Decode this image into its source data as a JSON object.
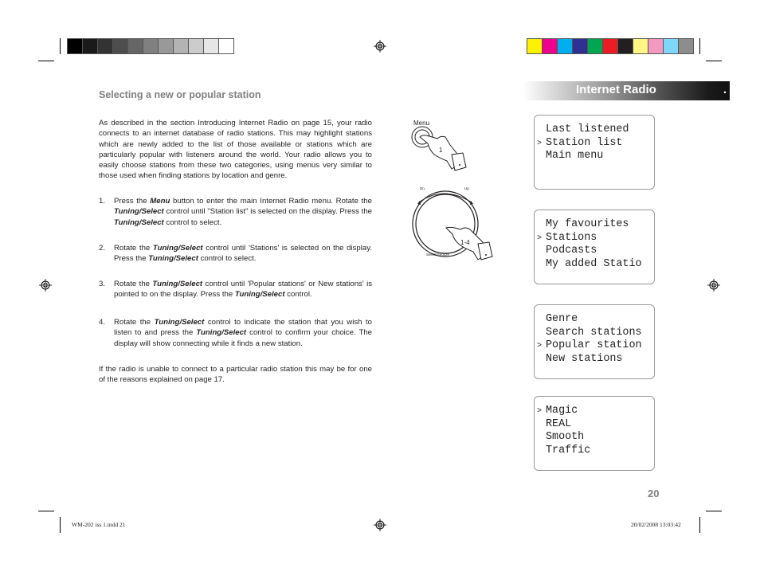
{
  "print_marks": {
    "grayscale_swatches": [
      "#000000",
      "#1a1a1a",
      "#333333",
      "#4d4d4d",
      "#666666",
      "#808080",
      "#999999",
      "#b3b3b3",
      "#cccccc",
      "#e6e6e6",
      "#ffffff"
    ],
    "color_swatches": [
      "#fff200",
      "#ec008c",
      "#00aeef",
      "#2e3192",
      "#00a651",
      "#ed1c24",
      "#231f20",
      "#fff685",
      "#f49ac1",
      "#7dd8f8",
      "#8d8d8d"
    ]
  },
  "section_banner": {
    "title": "Internet Radio",
    "trailing_mark": "."
  },
  "heading": "Selecting a new or popular station",
  "intro": "As described in the section Introducing Internet Radio on page 15, your radio connects to an internet database of radio stations. This may highlight stations which are newly added to the list of those available or stations which are particularly popular with listeners around the world. Your radio allows you to easily choose stations from these two categories, using menus very similar to those used when finding stations by location and genre.",
  "steps": [
    {
      "number": "1.",
      "parts": [
        "Press the ",
        "Menu",
        " button to enter the main Internet Radio menu. Rotate the ",
        "Tuning/Select",
        " control until \"Station list\" is selected on the display. Press the ",
        "Tuning/Select",
        " control to select."
      ]
    },
    {
      "number": "2.",
      "parts": [
        "Rotate the ",
        "Tuning/Select",
        " control until 'Stations' is selected on the display. Press the ",
        "Tuning/Select",
        " control to select."
      ]
    },
    {
      "number": "3.",
      "parts": [
        "Rotate the ",
        "Tuning/Select",
        " control until 'Popular stations' or New stations' is pointed to on the display. Press the ",
        "Tuning/Select",
        " control."
      ]
    },
    {
      "number": "4.",
      "parts": [
        "Rotate the ",
        "Tuning/Select",
        " control to indicate the station that you wish to listen to and press the ",
        "Tuning/Select",
        " control to confirm your choice. The display will show connecting while it finds a new station."
      ]
    }
  ],
  "footer_note": "If the radio is unable to connect to a particular radio station this may be for one of the reasons explained on page 17.",
  "illustration": {
    "menu_label": "Menu",
    "menu_step": "1",
    "dial_left": "Dn.",
    "dial_right": "Up",
    "dial_bottom": "Select/Snooze",
    "dial_step": "1-4"
  },
  "displays": [
    {
      "lines": [
        {
          "text": "Last listened",
          "selected": false
        },
        {
          "text": "Station list",
          "selected": true
        },
        {
          "text": "Main menu",
          "selected": false
        }
      ]
    },
    {
      "lines": [
        {
          "text": "My favourites",
          "selected": false
        },
        {
          "text": "Stations",
          "selected": true
        },
        {
          "text": "Podcasts",
          "selected": false
        },
        {
          "text": "My added Statio",
          "selected": false
        }
      ]
    },
    {
      "lines": [
        {
          "text": "Genre",
          "selected": false
        },
        {
          "text": "Search stations",
          "selected": false
        },
        {
          "text": "Popular station",
          "selected": true
        },
        {
          "text": "New stations",
          "selected": false
        }
      ]
    },
    {
      "lines": [
        {
          "text": "Magic",
          "selected": true
        },
        {
          "text": "REAL",
          "selected": false
        },
        {
          "text": "Smooth",
          "selected": false
        },
        {
          "text": "Traffic",
          "selected": false
        }
      ]
    }
  ],
  "cursor_glyph": ">",
  "page_number": "20",
  "slug_left": "WM-202 iss 1.indd   21",
  "slug_right": "20/02/2008   13:03:42"
}
